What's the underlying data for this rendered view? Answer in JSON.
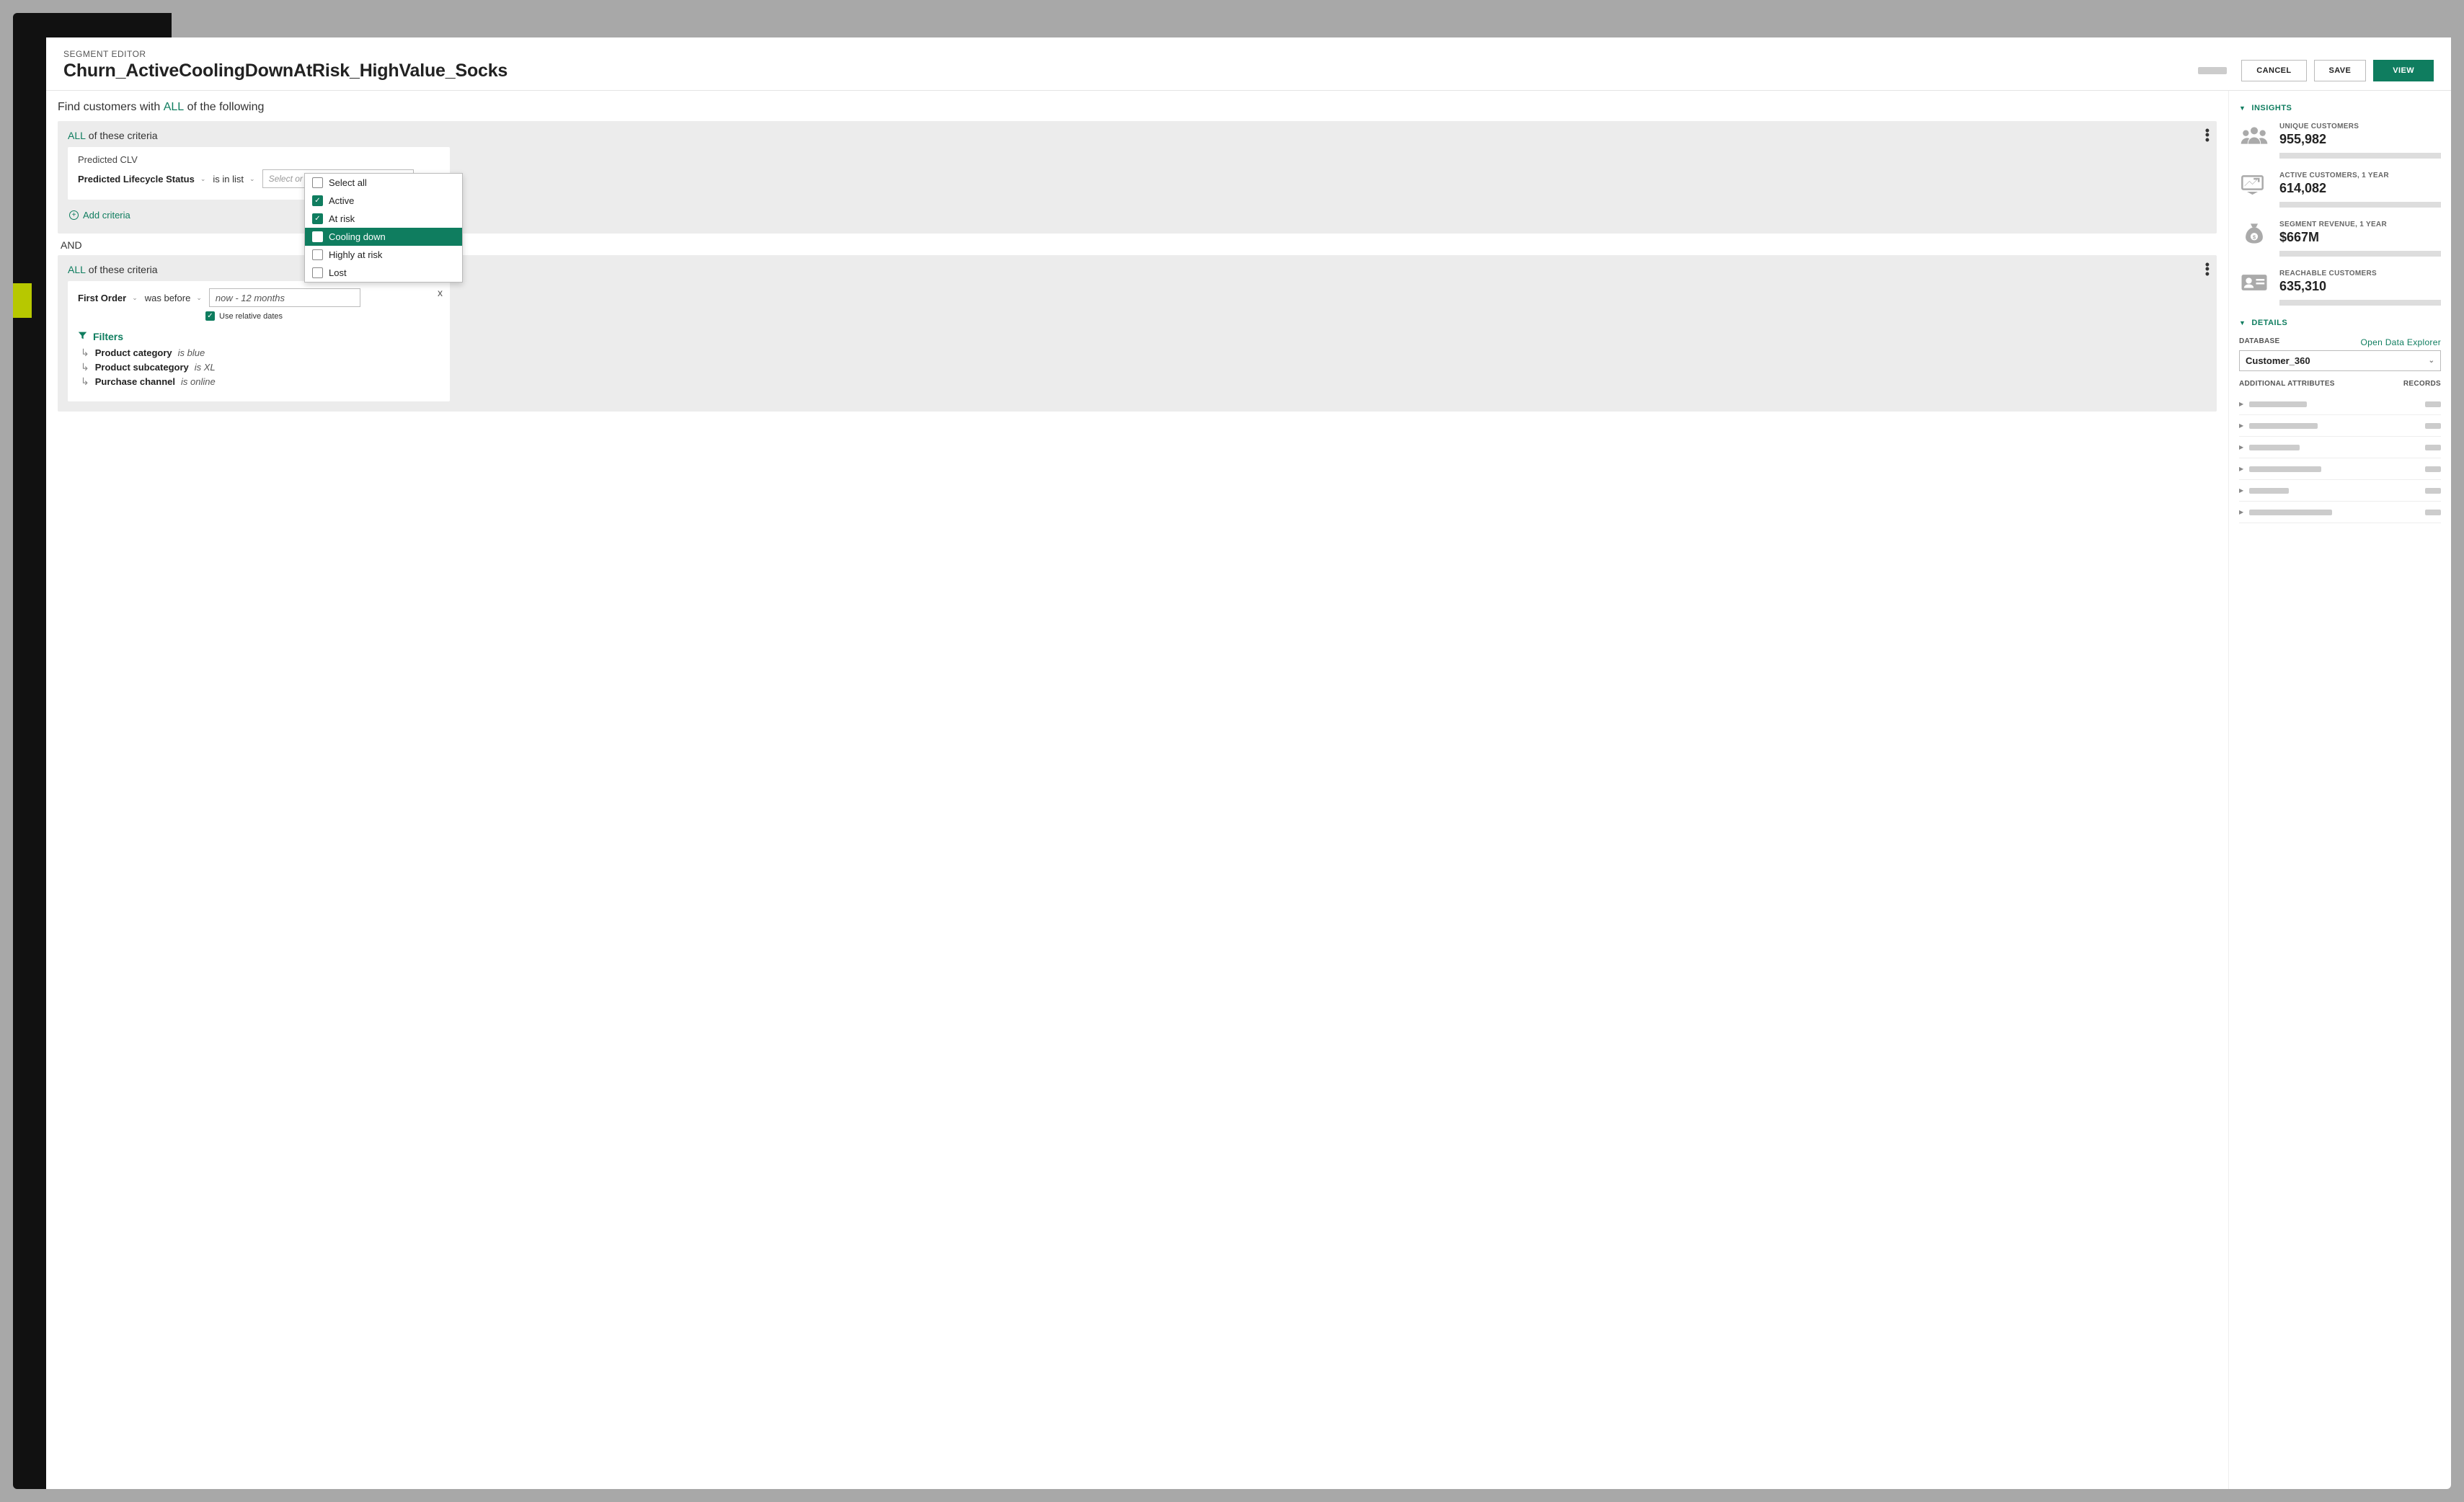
{
  "header": {
    "subtitle": "SEGMENT EDITOR",
    "title": "Churn_ActiveCoolingDownAtRisk_HighValue_Socks",
    "cancel": "CANCEL",
    "save": "SAVE",
    "view": "VIEW"
  },
  "findLine": {
    "prefix": "Find customers with ",
    "keyword": "ALL",
    "suffix": " of the following"
  },
  "group1": {
    "labelPrefix": "ALL",
    "labelSuffix": " of these criteria",
    "card": {
      "title": "Predicted CLV",
      "attribute": "Predicted Lifecycle Status",
      "operator": "is in list",
      "placeholder": "Select or search for values"
    },
    "dropdown": {
      "options": [
        {
          "label": "Select all",
          "checked": false
        },
        {
          "label": "Active",
          "checked": true
        },
        {
          "label": "At risk",
          "checked": true
        },
        {
          "label": "Cooling down",
          "checked": false,
          "hover": true
        },
        {
          "label": "Highly at risk",
          "checked": false
        },
        {
          "label": "Lost",
          "checked": false
        }
      ]
    },
    "addCriteria": "Add criteria"
  },
  "and": "AND",
  "group2": {
    "labelPrefix": "ALL",
    "labelSuffix": " of these criteria",
    "card": {
      "attribute": "First Order",
      "operator": "was before",
      "value": "now - 12 months",
      "relDates": "Use relative dates"
    },
    "filters": {
      "header": "Filters",
      "rows": [
        {
          "label": "Product category",
          "value": "is blue"
        },
        {
          "label": "Product subcategory",
          "value": "is XL"
        },
        {
          "label": "Purchase channel",
          "value": "is online"
        }
      ]
    }
  },
  "insights": {
    "title": "INSIGHTS",
    "metrics": [
      {
        "label": "UNIQUE CUSTOMERS",
        "value": "955,982",
        "icon": "users"
      },
      {
        "label": "ACTIVE CUSTOMERS, 1 YEAR",
        "value": "614,082",
        "icon": "trend"
      },
      {
        "label": "SEGMENT REVENUE, 1 YEAR",
        "value": "$667M",
        "icon": "moneybag"
      },
      {
        "label": "REACHABLE CUSTOMERS",
        "value": "635,310",
        "icon": "idcard"
      }
    ]
  },
  "details": {
    "title": "DETAILS",
    "databaseLabel": "DATABASE",
    "openExplorer": "Open Data Explorer",
    "database": "Customer_360",
    "attrHead": {
      "left": "ADDITIONAL ATTRIBUTES",
      "right": "RECORDS"
    },
    "rows": [
      80,
      95,
      70,
      100,
      55,
      115
    ]
  }
}
